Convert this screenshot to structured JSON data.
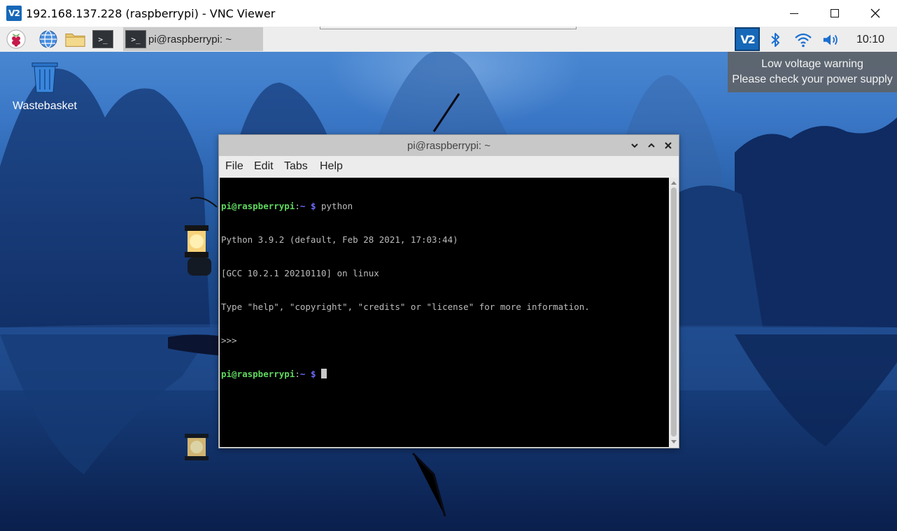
{
  "vnc": {
    "title": "192.168.137.228 (raspberrypi) - VNC Viewer",
    "logo_text": "V2",
    "logo_icon": "vnc-logo-icon"
  },
  "taskbar": {
    "menu_icon": "raspberry-icon",
    "browser_icon": "globe-icon",
    "files_icon": "folder-icon",
    "terminal_icon": "terminal-icon",
    "terminal_glyph": ">_",
    "task_label": "pi@raspberrypi: ~",
    "vnc_status_text": "V2",
    "clock": "10:10",
    "status_icons": [
      "bluetooth-icon",
      "wifi-icon",
      "volume-icon"
    ]
  },
  "tooltip": {
    "line1": "Low voltage warning",
    "line2": "Please check your power supply"
  },
  "desktop": {
    "icons": [
      {
        "label": "Wastebasket",
        "icon": "trash-icon"
      }
    ]
  },
  "terminal": {
    "title": "pi@raspberrypi: ~",
    "menu": [
      "File",
      "Edit",
      "Tabs",
      "Help"
    ],
    "prompt_user": "pi@raspberrypi",
    "prompt_sep": ":",
    "prompt_path": "~ $",
    "command": " python",
    "output": [
      "Python 3.9.2 (default, Feb 28 2021, 17:03:44)",
      "[GCC 10.2.1 20210110] on linux",
      "Type \"help\", \"copyright\", \"credits\" or \"license\" for more information.",
      ">>>"
    ]
  },
  "colors": {
    "prompt_user": "#5fd75f",
    "prompt_path": "#6c6cff",
    "vnc_blue": "#1668b8",
    "taskbar_bg": "#ededed"
  }
}
